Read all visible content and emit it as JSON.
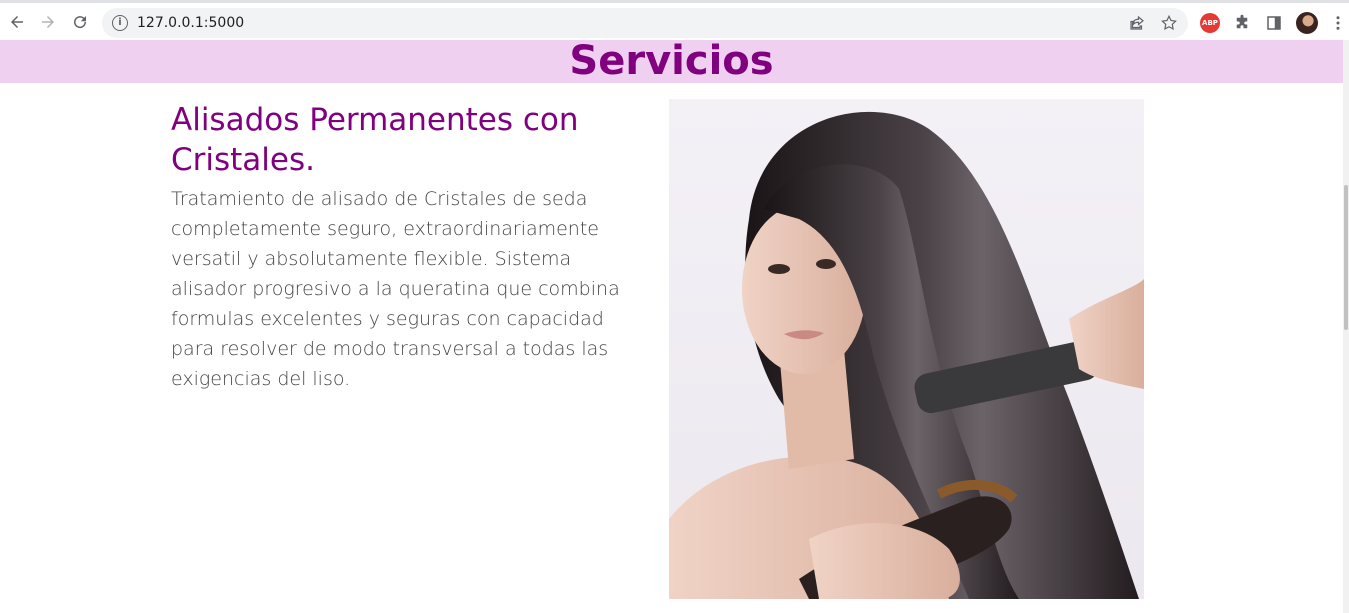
{
  "browser": {
    "url": "127.0.0.1:5000",
    "extensions": [
      "ABP"
    ]
  },
  "page": {
    "section_title": "Servicios",
    "service": {
      "title": "Alisados Permanentes con Cristales.",
      "description": "Tratamiento de alisado de Cristales de seda completamente seguro, extraordinariamente versatil y absolutamente flexible. Sistema alisador progresivo a la queratina que combina formulas excelentes y seguras con capacidad para resolver de modo transversal a todas las exigencias del liso."
    }
  },
  "colors": {
    "accent": "#800080",
    "band_background": "#f0d0f0",
    "body_text": "#444444"
  }
}
